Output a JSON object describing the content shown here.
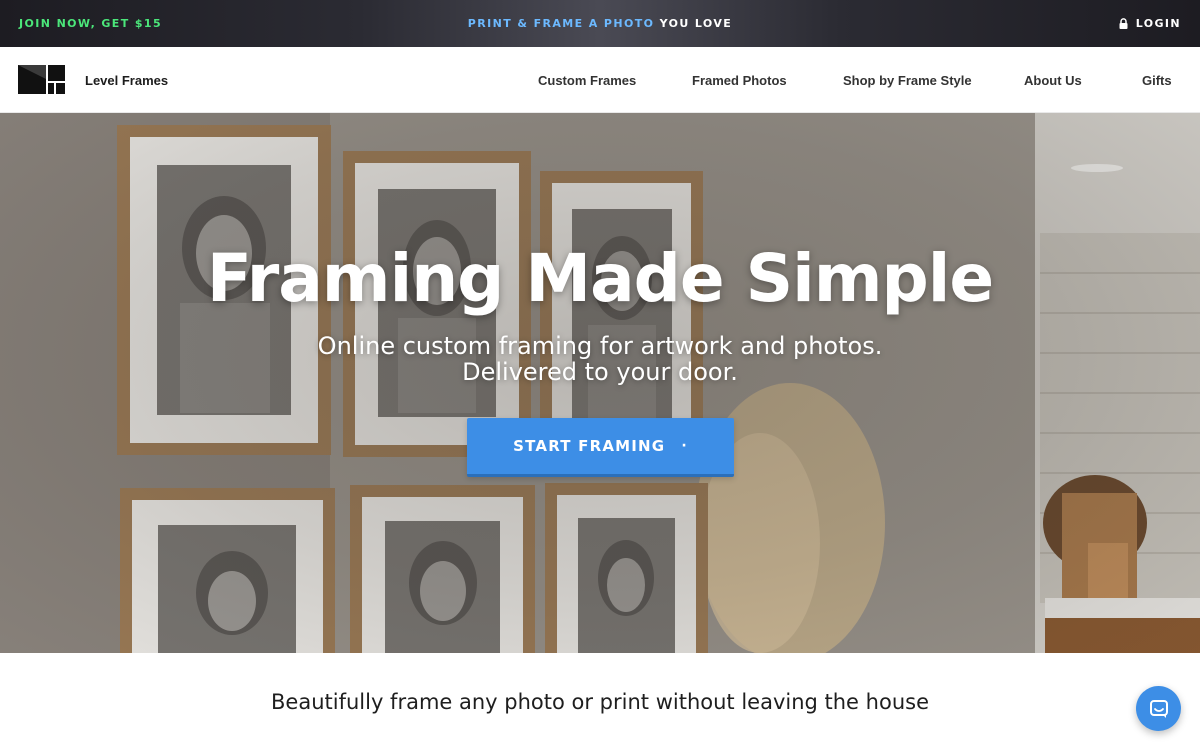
{
  "topbar": {
    "join": "JOIN NOW, GET $15",
    "promo_highlight": "PRINT & FRAME A PHOTO",
    "promo_rest": "YOU LOVE",
    "login": "LOGIN"
  },
  "nav": {
    "brand": "Level Frames",
    "items": [
      {
        "label": "Custom Frames"
      },
      {
        "label": "Framed Photos"
      },
      {
        "label": "Shop by Frame Style"
      },
      {
        "label": "About Us"
      },
      {
        "label": "Gifts"
      }
    ]
  },
  "hero": {
    "title": "Framing Made Simple",
    "subtitle_line1": "Online custom framing for artwork and photos.",
    "subtitle_line2": "Delivered to your door.",
    "cta": "START FRAMING",
    "cta_icon": "·"
  },
  "tagline": "Beautifully frame any photo or print without leaving the house",
  "colors": {
    "accent": "#3d8ee6",
    "join_green": "#4be67a",
    "promo_blue": "#6cb9ff"
  },
  "icons": {
    "login": "lock-icon",
    "logo": "level-frames-logo-icon",
    "chat": "chat-bubble-icon"
  }
}
